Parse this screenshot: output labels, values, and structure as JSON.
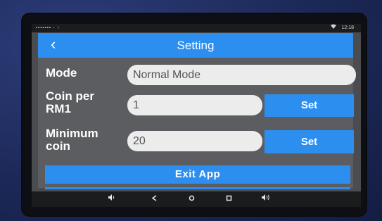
{
  "status_bar": {
    "left_icons": "▪▪▪▪▪▪▪ ◦ ↑",
    "wifi_icon": "wifi-icon",
    "time": "12:18"
  },
  "app_bar": {
    "back_glyph": "‹",
    "title": "Setting"
  },
  "form": {
    "mode": {
      "label": "Mode",
      "value": "Normal Mode"
    },
    "coin_per_rm1": {
      "label_line1": "Coin per",
      "label_line2": "RM1",
      "value": "1",
      "button": "Set"
    },
    "minimum_coin": {
      "label_line1": "Minimum",
      "label_line2": "coin",
      "value": "20",
      "button": "Set"
    }
  },
  "exit_button": "Exit App",
  "nav_bar": {
    "volume_down_glyph": "🔈",
    "back_glyph": "◁",
    "home_glyph": "○",
    "recents_glyph": "□",
    "volume_up_glyph": "🔊"
  },
  "colors": {
    "accent": "#2c8ff0",
    "panel": "#5b5d60",
    "field": "#ececec"
  }
}
